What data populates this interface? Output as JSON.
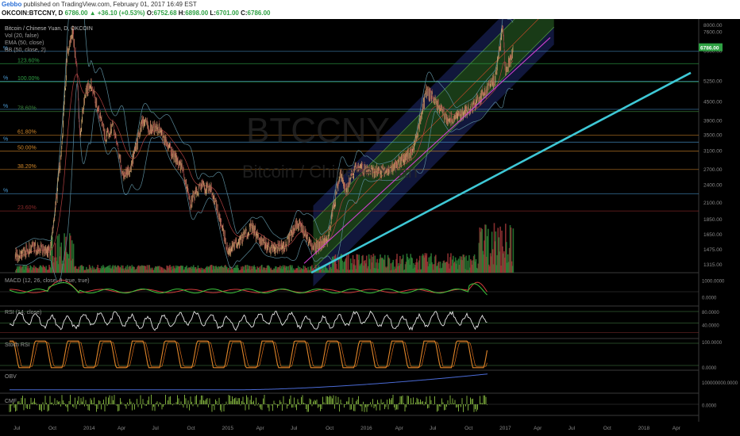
{
  "header": {
    "author": "Gebbo",
    "published": "published on TradingView.com, February 01, 2017 16:49 EST",
    "symbol": "OKCOIN:BTCCNY, D",
    "last": "6786.00",
    "change": "▲ +36.10 (+0.53%)",
    "o_label": "O:",
    "o": "6752.68",
    "h_label": "H:",
    "h": "6898.00",
    "l_label": "L:",
    "l": "6701.00",
    "c_label": "C:",
    "c": "6786.00"
  },
  "main_legend": {
    "line1": "Bitcoin / Chinese Yuan, D, OKCOIN",
    "line2": "Vol (20, false)",
    "line3": "EMA (50, close)",
    "line4": "BB (50, close, 2)"
  },
  "watermark": {
    "symbol": "BTCCNY",
    "name": "Bitcoin / Chinese Yuan"
  },
  "price_tag": "6786.00",
  "colors": {
    "bg": "#000000",
    "up": "#26a69a",
    "down": "#ef5350",
    "channel_green": "#2e6b2a",
    "channel_blue": "#1f2a6e",
    "trend_cyan": "#3ec8d6",
    "trend_magenta": "#d040d0",
    "fib_green": "#3c8a3c",
    "fib_orange": "#d68a2a",
    "fib_red": "#8a2a2a"
  },
  "fib_levels": [
    {
      "label": "%",
      "price": 6580,
      "color": "#4a9ad4"
    },
    {
      "label": "123.60%",
      "price": 6000,
      "color": "#2f9e44"
    },
    {
      "label": "%",
      "price": 5250,
      "color": "#4a9ad4"
    },
    {
      "label": "100.00%",
      "price": 5230,
      "color": "#2f9e44"
    },
    {
      "label": "%",
      "price": 4250,
      "color": "#4a9ad4"
    },
    {
      "label": "78.60%",
      "price": 4180,
      "color": "#3c8a3c"
    },
    {
      "label": "61.80%",
      "price": 3500,
      "color": "#d68a2a"
    },
    {
      "label": "%",
      "price": 3320,
      "color": "#4a9ad4"
    },
    {
      "label": "50.00%",
      "price": 3100,
      "color": "#d68a2a"
    },
    {
      "label": "38.20%",
      "price": 2700,
      "color": "#d68a2a"
    },
    {
      "label": "%",
      "price": 2250,
      "color": "#4a9ad4"
    },
    {
      "label": "23.60%",
      "price": 1975,
      "color": "#8a2a2a"
    }
  ],
  "chart_data": [
    {
      "type": "line",
      "panel": "price",
      "title": "Bitcoin / Chinese Yuan, D, OKCOIN",
      "y_ticks": [
        "8000.00",
        "7600.00",
        "6600.00",
        "5250.00",
        "4500.00",
        "3900.00",
        "3500.00",
        "3100.00",
        "2700.00",
        "2400.00",
        "2100.00",
        "1850.00",
        "1650.00",
        "1475.00",
        "1315.00"
      ],
      "x_ticks": [
        "Jul",
        "Oct",
        "2014",
        "Apr",
        "Jul",
        "Oct",
        "2015",
        "Apr",
        "Jul",
        "Oct",
        "2016",
        "Apr",
        "Jul",
        "Oct",
        "2017",
        "Apr",
        "Jul",
        "Oct",
        "2018",
        "Apr"
      ],
      "ylim": [
        1240,
        8200
      ],
      "scale": "log",
      "series": [
        {
          "x": [
            "2013-07-01",
            "2013-08-15",
            "2013-10-01",
            "2013-10-15",
            "2013-11-01",
            "2013-11-15",
            "2013-11-30",
            "2013-12-10",
            "2013-12-18",
            "2013-12-31",
            "2014-01-15",
            "2014-02-01",
            "2014-02-25",
            "2014-03-15",
            "2014-04-10",
            "2014-05-01",
            "2014-06-01",
            "2014-06-20",
            "2014-07-15",
            "2014-08-15",
            "2014-09-15",
            "2014-10-05",
            "2014-11-01",
            "2014-12-01",
            "2015-01-14",
            "2015-02-15",
            "2015-03-15",
            "2015-04-15",
            "2015-05-15",
            "2015-06-15",
            "2015-07-10",
            "2015-08-01",
            "2015-08-25",
            "2015-10-01",
            "2015-11-04",
            "2015-11-20",
            "2015-12-15",
            "2016-01-15",
            "2016-02-15",
            "2016-03-15",
            "2016-04-15",
            "2016-05-15",
            "2016-06-18",
            "2016-07-15",
            "2016-08-15",
            "2016-09-15",
            "2016-10-15",
            "2016-11-15",
            "2016-12-15",
            "2017-01-05",
            "2017-01-12",
            "2017-01-25",
            "2017-02-01"
          ],
          "values": [
            1400,
            1500,
            1450,
            2000,
            3300,
            6500,
            7600,
            5800,
            3500,
            4700,
            5200,
            4400,
            3400,
            3800,
            2600,
            2700,
            3900,
            3700,
            3700,
            3100,
            2700,
            2100,
            2400,
            2300,
            1450,
            1600,
            1750,
            1550,
            1480,
            1520,
            1800,
            1700,
            1480,
            1600,
            2600,
            2300,
            2800,
            2650,
            2650,
            2700,
            2900,
            3100,
            4900,
            4450,
            3900,
            4100,
            4300,
            4800,
            5300,
            7800,
            5600,
            6200,
            6786
          ]
        }
      ]
    },
    {
      "type": "line",
      "panel": "MACD",
      "title": "MACD (12, 26, close, 9, true, true)",
      "y_ticks": [
        "1000.0000",
        "0.0000"
      ],
      "ylim": [
        -500,
        1000
      ]
    },
    {
      "type": "line",
      "panel": "RSI",
      "title": "RSI (14, close)",
      "y_ticks": [
        "80.0000",
        "40.0000"
      ],
      "ylim": [
        10,
        95
      ]
    },
    {
      "type": "line",
      "panel": "Stoch",
      "title": "Stoch RSI",
      "y_ticks": [
        "100.0000",
        "0.0000"
      ],
      "ylim": [
        -5,
        105
      ]
    },
    {
      "type": "line",
      "panel": "OBV",
      "title": "OBV",
      "y_ticks": [
        "100000000.0000"
      ],
      "ylim": [
        0,
        1
      ]
    },
    {
      "type": "bar",
      "panel": "CMF",
      "title": "CMF",
      "y_ticks": [
        "0.0000"
      ],
      "ylim": [
        -1,
        1
      ]
    }
  ]
}
